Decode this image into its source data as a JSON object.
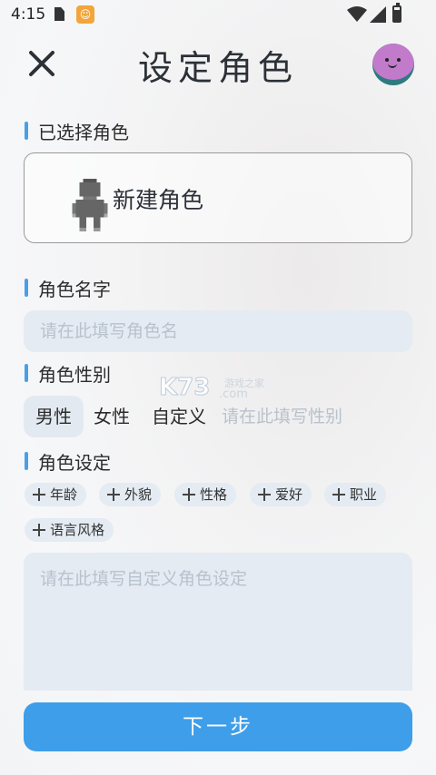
{
  "status_bar": {
    "time": "4:15",
    "app_icon_glyph": "☺"
  },
  "header": {
    "title": "设定角色"
  },
  "selected_character": {
    "label": "已选择角色",
    "card_name": "新建角色"
  },
  "name": {
    "label": "角色名字",
    "placeholder": "请在此填写角色名"
  },
  "gender": {
    "label": "角色性别",
    "options": [
      {
        "label": "男性",
        "selected": true
      },
      {
        "label": "女性",
        "selected": false
      },
      {
        "label": "自定义",
        "selected": false
      }
    ],
    "placeholder": "请在此填写性别"
  },
  "settings": {
    "label": "角色设定",
    "tags": [
      "年龄",
      "外貌",
      "性格",
      "爱好",
      "职业",
      "语言风格"
    ],
    "placeholder": "请在此填写自定义角色设定"
  },
  "watermark": {
    "brand": "K73",
    "site": "游戏之家",
    "domain": ".com"
  },
  "next_button": {
    "label": "下一步"
  },
  "colors": {
    "accent": "#3f9ee9",
    "field_bg": "#e4ebf2",
    "avatar_face": "#c27acb",
    "avatar_base": "#2f7a80"
  }
}
